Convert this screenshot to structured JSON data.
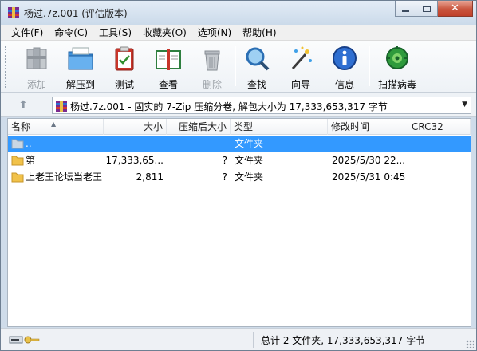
{
  "window": {
    "title": "杨过.7z.001 (评估版本)",
    "app_icon": "winrar-icon"
  },
  "menu": [
    {
      "label": "文件(F)"
    },
    {
      "label": "命令(C)"
    },
    {
      "label": "工具(S)"
    },
    {
      "label": "收藏夹(O)"
    },
    {
      "label": "选项(N)"
    },
    {
      "label": "帮助(H)"
    }
  ],
  "toolbar": {
    "add": {
      "label": "添加",
      "icon": "books-icon",
      "enabled": false
    },
    "extract": {
      "label": "解压到",
      "icon": "folder-extract-icon"
    },
    "test": {
      "label": "测试",
      "icon": "clipboard-check-icon"
    },
    "view": {
      "label": "查看",
      "icon": "open-book-icon"
    },
    "delete": {
      "label": "删除",
      "icon": "trash-icon",
      "enabled": false
    },
    "find": {
      "label": "查找",
      "icon": "magnifier-icon"
    },
    "wizard": {
      "label": "向导",
      "icon": "magic-wand-icon"
    },
    "info": {
      "label": "信息",
      "icon": "info-icon"
    },
    "scan": {
      "label": "扫描病毒",
      "icon": "virus-scan-icon"
    }
  },
  "address": {
    "text": "杨过.7z.001 - 固实的 7-Zip 压缩分卷, 解包大小为 17,333,653,317 字节"
  },
  "columns": {
    "name": "名称",
    "size": "大小",
    "packed": "压缩后大小",
    "type": "类型",
    "modified": "修改时间",
    "crc": "CRC32"
  },
  "rows": [
    {
      "name": "..",
      "size": "",
      "packed": "",
      "type": "文件夹",
      "modified": "",
      "crc": "",
      "selected": true
    },
    {
      "name": "第一",
      "size": "17,333,65...",
      "packed": "?",
      "type": "文件夹",
      "modified": "2025/5/30 22...",
      "crc": "",
      "selected": false
    },
    {
      "name": "上老王论坛当老王",
      "size": "2,811",
      "packed": "?",
      "type": "文件夹",
      "modified": "2025/5/31 0:45",
      "crc": "",
      "selected": false
    }
  ],
  "status": {
    "summary": "总计 2 文件夹, 17,333,653,317 字节"
  },
  "colors": {
    "selection": "#3399ff",
    "folder": "#f1c24a"
  }
}
